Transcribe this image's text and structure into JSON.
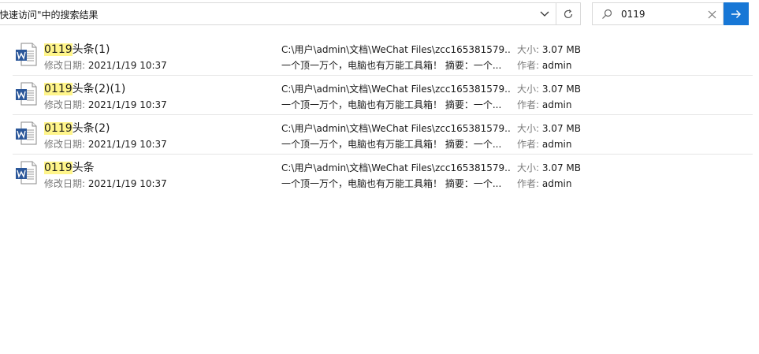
{
  "address_bar": {
    "text": "快速访问\"中的搜索结果"
  },
  "search": {
    "value": "0119"
  },
  "labels": {
    "date_prefix": "修改日期: ",
    "size_prefix": "大小: ",
    "author_prefix": "作者: "
  },
  "results": [
    {
      "name_highlight": "0119",
      "name_rest": "头条(1)",
      "modified": "2021/1/19 10:37",
      "path": "C:\\用户\\admin\\文档\\WeChat Files\\zcc165381579...",
      "summary": "一个顶一万个，电脑也有万能工具箱！  摘要：一个...",
      "size": "3.07 MB",
      "author": "admin",
      "icon": "word-document-icon"
    },
    {
      "name_highlight": "0119",
      "name_rest": "头条(2)(1)",
      "modified": "2021/1/19 10:37",
      "path": "C:\\用户\\admin\\文档\\WeChat Files\\zcc165381579...",
      "summary": "一个顶一万个，电脑也有万能工具箱！  摘要：一个...",
      "size": "3.07 MB",
      "author": "admin",
      "icon": "word-document-icon"
    },
    {
      "name_highlight": "0119",
      "name_rest": "头条(2)",
      "modified": "2021/1/19 10:37",
      "path": "C:\\用户\\admin\\文档\\WeChat Files\\zcc165381579...",
      "summary": "一个顶一万个，电脑也有万能工具箱！  摘要：一个...",
      "size": "3.07 MB",
      "author": "admin",
      "icon": "word-document-icon"
    },
    {
      "name_highlight": "0119",
      "name_rest": "头条",
      "modified": "2021/1/19 10:37",
      "path": "C:\\用户\\admin\\文档\\WeChat Files\\zcc165381579...",
      "summary": "一个顶一万个，电脑也有万能工具箱！  摘要：一个...",
      "size": "3.07 MB",
      "author": "admin",
      "icon": "word-document-icon"
    }
  ],
  "colors": {
    "accent": "#1777d6",
    "highlight": "#fff58a",
    "label_gray": "#7a7a7a",
    "word_blue": "#2b579a"
  }
}
